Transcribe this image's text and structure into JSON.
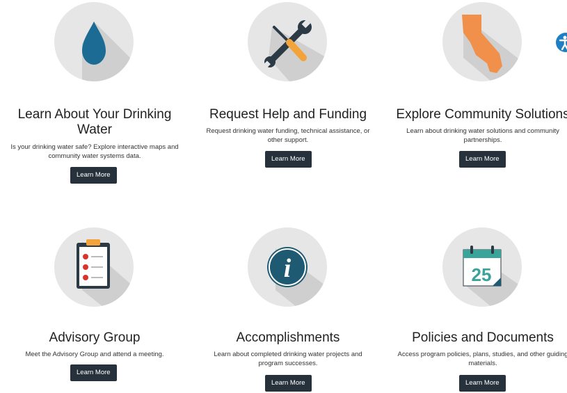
{
  "cards": [
    {
      "icon": "water-drop-icon",
      "title": "Learn About Your Drinking Water",
      "description": "Is your drinking water safe? Explore interactive maps and community water systems data.",
      "button": "Learn More"
    },
    {
      "icon": "tools-icon",
      "title": "Request Help and Funding",
      "description": "Request drinking water funding, technical assistance, or other support.",
      "button": "Learn More"
    },
    {
      "icon": "california-map-icon",
      "title": "Explore Community Solutions",
      "description": "Learn about drinking water solutions and community partnerships.",
      "button": "Learn More"
    },
    {
      "icon": "clipboard-checklist-icon",
      "title": "Advisory Group",
      "description": "Meet the Advisory Group and attend a meeting.",
      "button": "Learn More"
    },
    {
      "icon": "info-icon",
      "title": "Accomplishments",
      "description": "Learn about completed drinking water projects and program successes.",
      "button": "Learn More"
    },
    {
      "icon": "calendar-icon",
      "title": "Policies and Documents",
      "description": "Access program policies, plans, studies, and other guiding materials.",
      "button": "Learn More"
    }
  ],
  "calendar_day": "25",
  "accessibility_icon": "accessibility-icon",
  "colors": {
    "button_bg": "#26313b",
    "circle_bg": "#e6e6e6",
    "drop_blue": "#1b6b95",
    "california_orange": "#f0904a",
    "info_teal": "#1f5a73",
    "calendar_teal": "#3aa39a",
    "accessibility_blue": "#1f7fc4"
  }
}
